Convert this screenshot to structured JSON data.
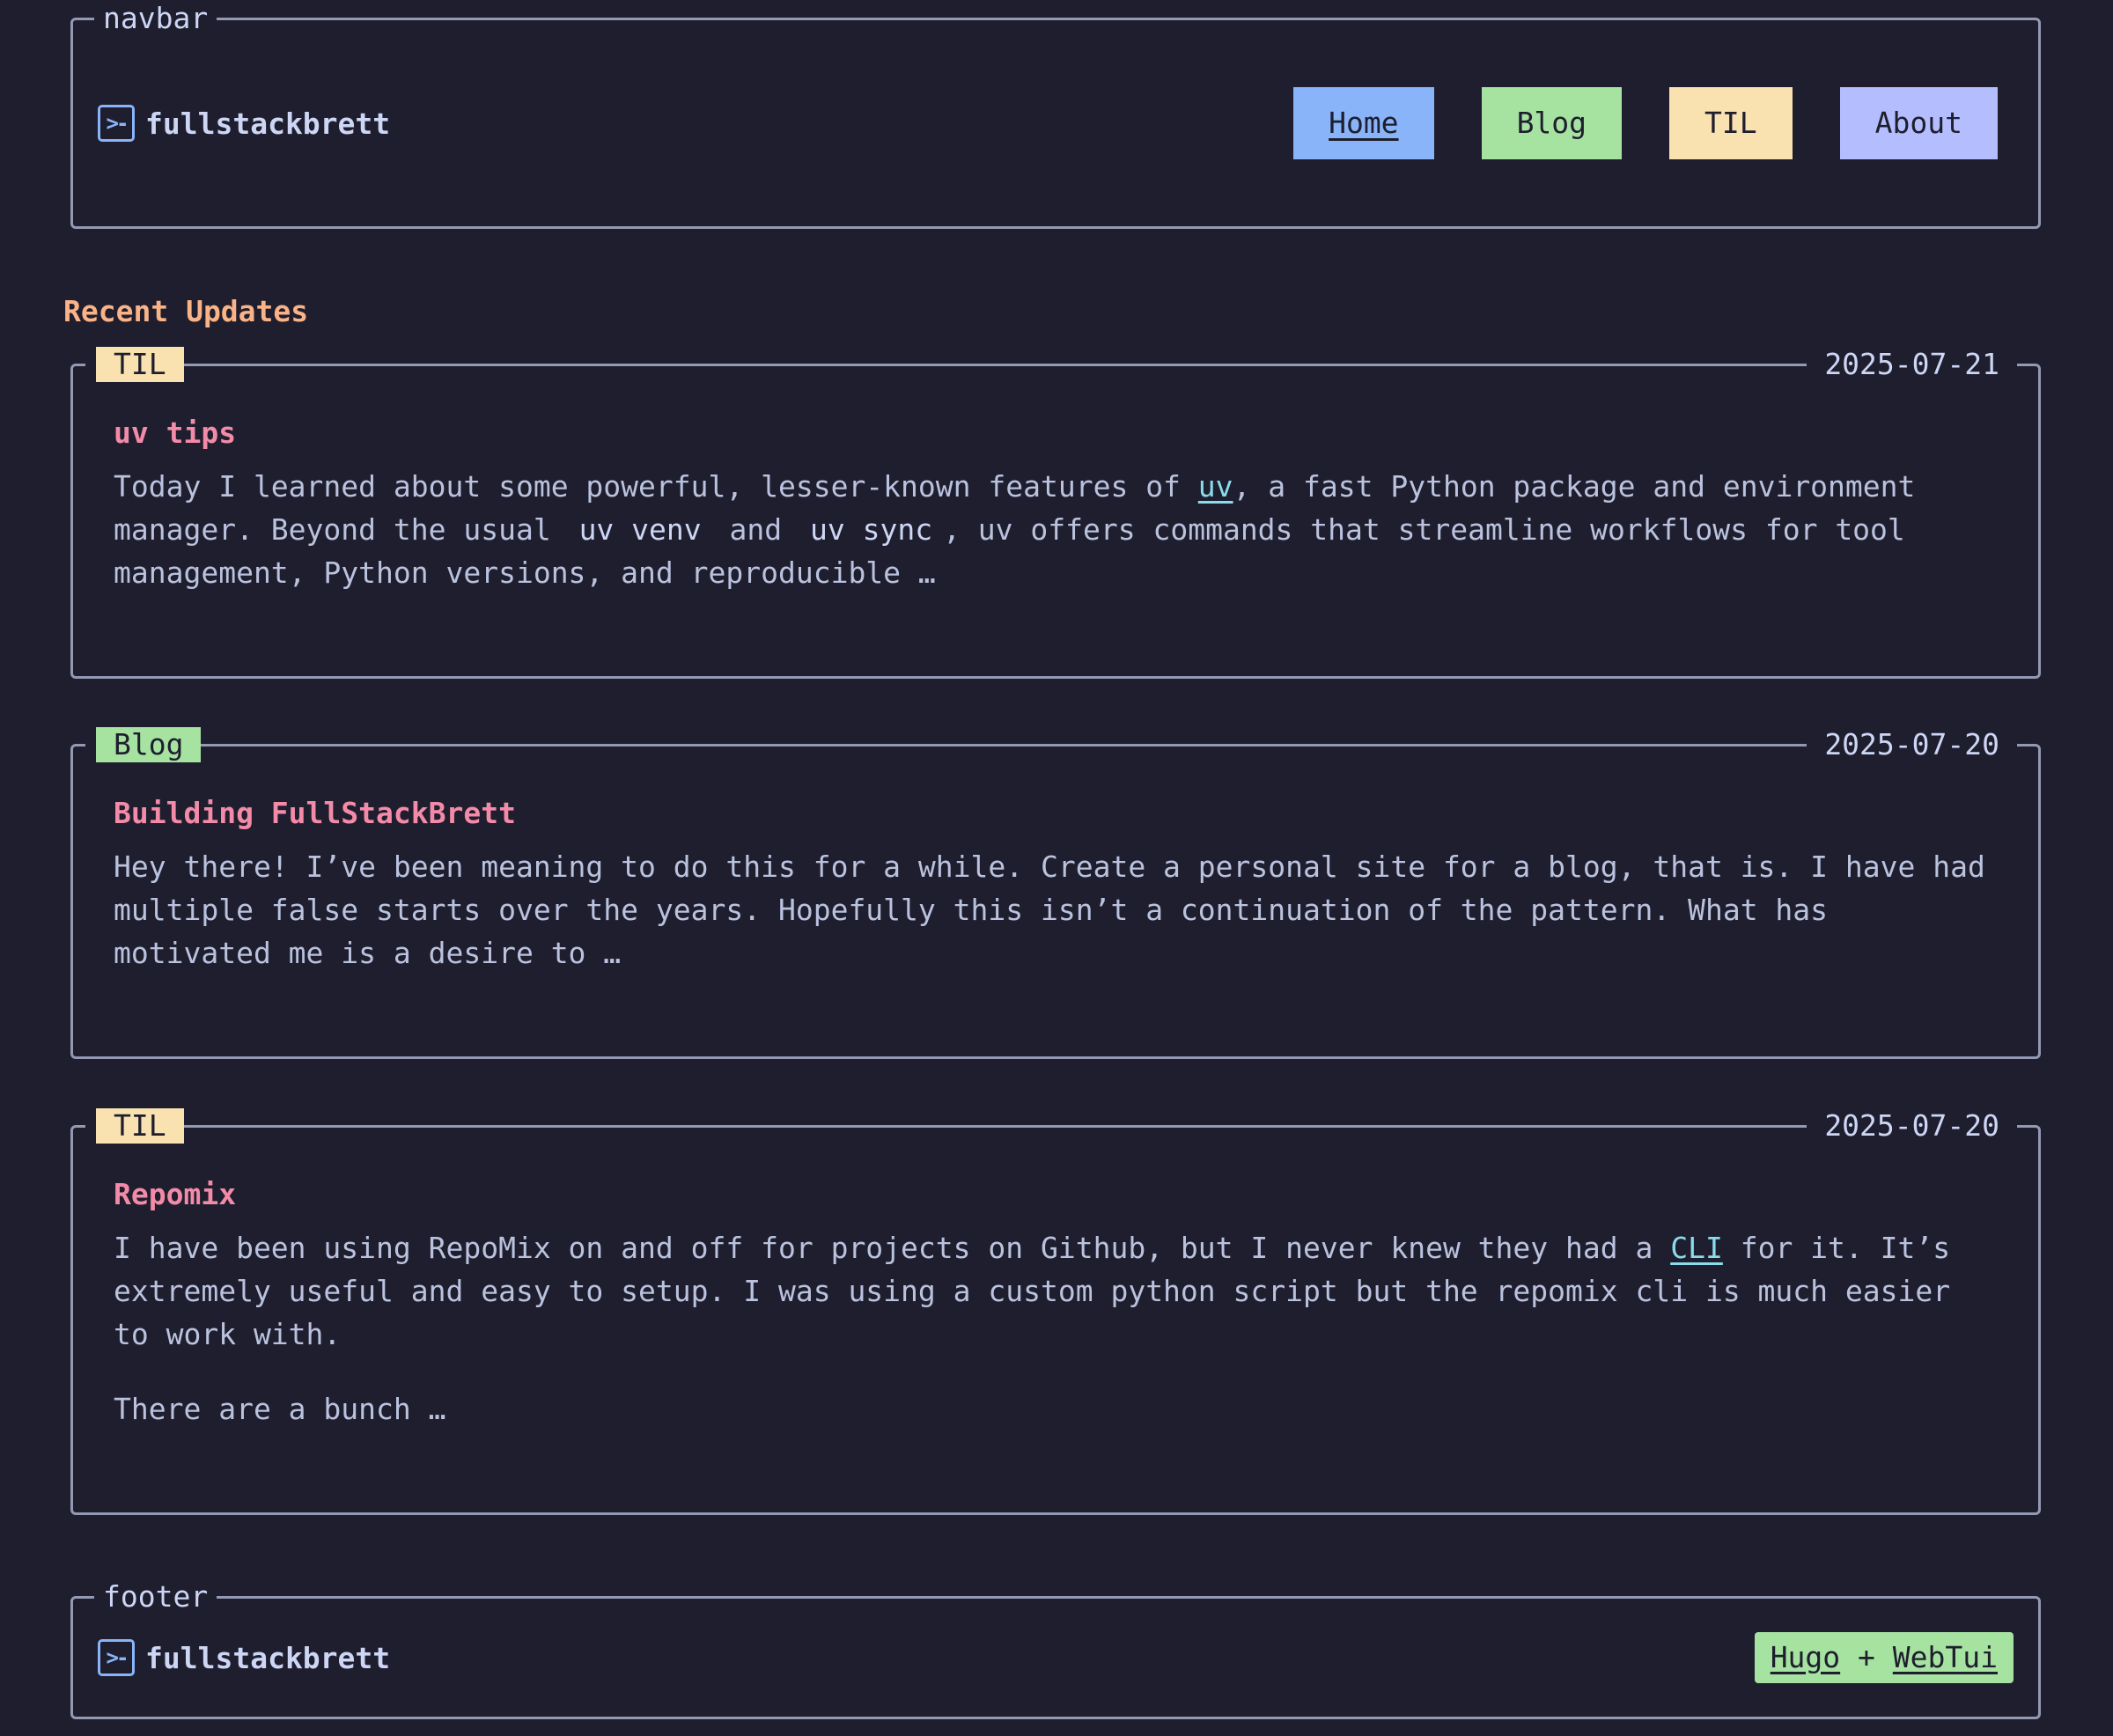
{
  "navbar": {
    "legend": "navbar",
    "brand_icon": ">-",
    "brand": "fullstackbrett",
    "links": [
      {
        "label": "Home",
        "color": "#89b4fa"
      },
      {
        "label": "Blog",
        "color": "#a6e3a1"
      },
      {
        "label": "TIL",
        "color": "#f9e2af"
      },
      {
        "label": "About",
        "color": "#b4befe"
      }
    ]
  },
  "section_heading": "Recent Updates",
  "posts": [
    {
      "tag": "TIL",
      "date": "2025-07-21",
      "title": "uv tips",
      "body": {
        "t1": "Today I learned about some powerful, lesser-known features of ",
        "link": "uv",
        "t2": ", a fast Python package and environment manager. Beyond the usual ",
        "code1": "uv venv",
        "t3": " and ",
        "code2": "uv sync",
        "t4": ", uv offers commands that streamline workflows for tool management, Python versions, and reproducible …"
      }
    },
    {
      "tag": "Blog",
      "date": "2025-07-20",
      "title": "Building FullStackBrett",
      "body": {
        "text": "Hey there! I’ve been meaning to do this for a while. Create a personal site for a blog, that is. I have had multiple false starts over the years. Hopefully this isn’t a continuation of the pattern. What has motivated me is a desire to …"
      }
    },
    {
      "tag": "TIL",
      "date": "2025-07-20",
      "title": "Repomix",
      "body": {
        "t1": "I have been using RepoMix on and off for projects on Github, but I never knew they had a ",
        "link": "CLI",
        "t2": " for it. It’s extremely useful and easy to setup. I was using a custom python script but the repomix cli is much easier to work with.",
        "p2": "There are a bunch …"
      }
    }
  ],
  "footer": {
    "legend": "footer",
    "brand_icon": ">-",
    "brand": "fullstackbrett",
    "credit_link1": "Hugo",
    "credit_sep": " + ",
    "credit_link2": "WebTui"
  },
  "colors": {
    "background": "#1e1e2e",
    "border": "#9399b2",
    "heading": "#fab387",
    "post_title": "#f38ba8",
    "link": "#89dceb"
  }
}
